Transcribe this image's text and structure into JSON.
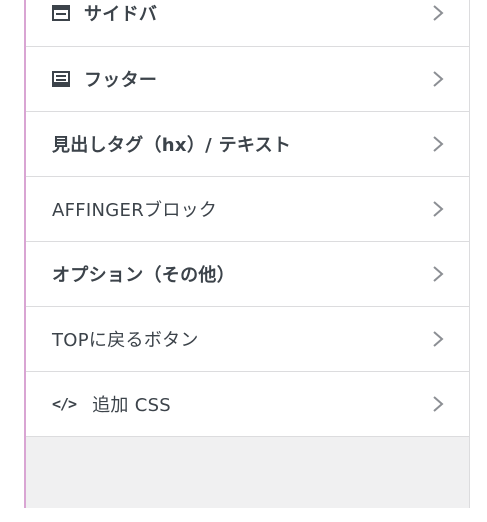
{
  "menu": {
    "items": [
      {
        "label": "サイドバ",
        "icon": "layout-icon",
        "weight": "bold"
      },
      {
        "label": "フッター",
        "icon": "footer-icon",
        "weight": "bold"
      },
      {
        "label": "見出しタグ（hx）/ テキスト",
        "icon": "",
        "weight": "bold"
      },
      {
        "label": "AFFINGERブロック",
        "icon": "",
        "weight": "light"
      },
      {
        "label": "オプション（その他）",
        "icon": "",
        "weight": "bold"
      },
      {
        "label": "TOPに戻るボタン",
        "icon": "",
        "weight": "light"
      },
      {
        "label": "追加 CSS",
        "icon": "code-icon",
        "code_glyph": "</>",
        "weight": "light"
      }
    ]
  },
  "colors": {
    "text": "#3c434a",
    "divider": "#dcdcde",
    "panel_bg": "#f0f0f1",
    "accent_border": "#d9a5d3",
    "chevron": "#8c8f94"
  }
}
